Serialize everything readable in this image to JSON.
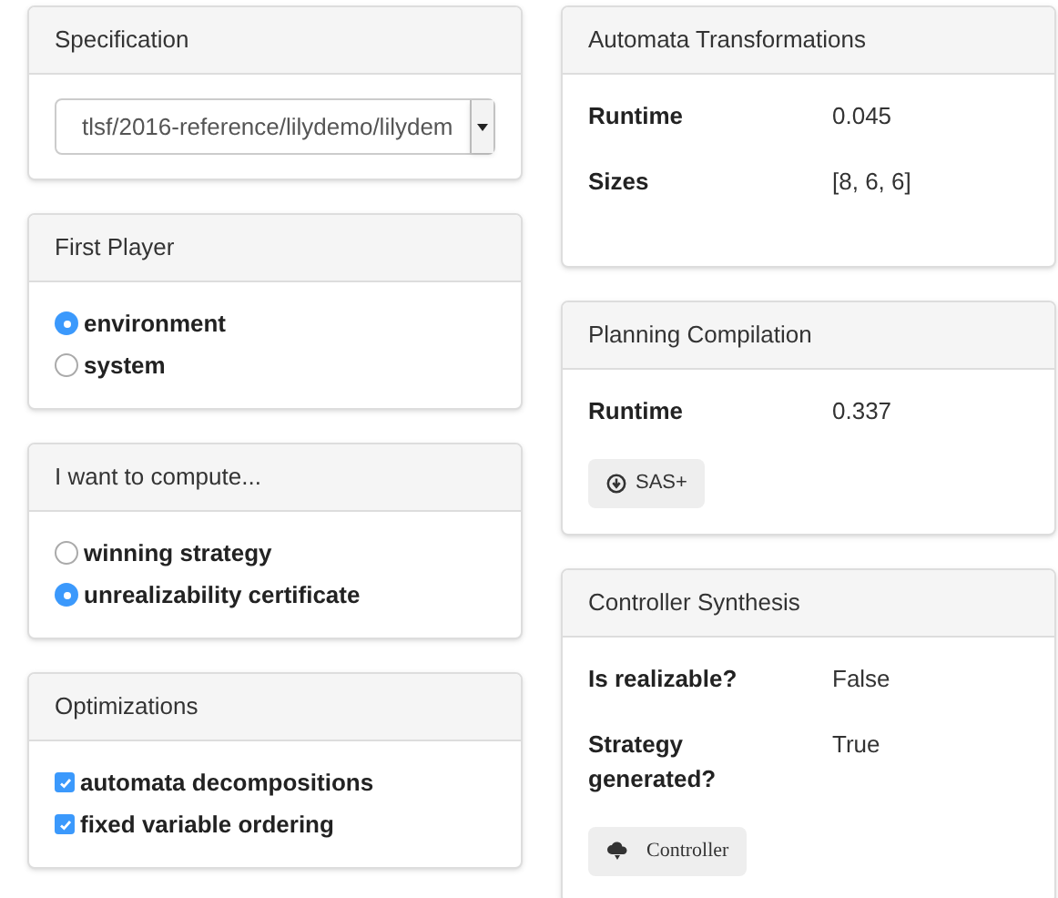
{
  "left_panels": [
    {
      "kind": "select",
      "title": "Specification",
      "value": "tlsf/2016-reference/lilydemo/lilydem"
    },
    {
      "kind": "radio",
      "title": "First Player",
      "options": [
        {
          "label": "environment",
          "selected": true
        },
        {
          "label": "system",
          "selected": false
        }
      ]
    },
    {
      "kind": "radio",
      "title": "I want to compute...",
      "options": [
        {
          "label": "winning strategy",
          "selected": false
        },
        {
          "label": "unrealizability certificate",
          "selected": true
        }
      ]
    },
    {
      "kind": "checkbox",
      "title": "Optimizations",
      "options": [
        {
          "label": "automata decompositions",
          "checked": true
        },
        {
          "label": "fixed variable ordering",
          "checked": true
        }
      ]
    }
  ],
  "right_panels": [
    {
      "title": "Automata Transformations",
      "rows": [
        {
          "label": "Runtime",
          "value": "0.045"
        },
        {
          "label": "Sizes",
          "value": "[8, 6, 6]"
        }
      ]
    },
    {
      "title": "Planning Compilation",
      "rows": [
        {
          "label": "Runtime",
          "value": "0.337"
        }
      ],
      "button": {
        "label": "SAS+",
        "kind": "download"
      }
    },
    {
      "title": "Controller Synthesis",
      "rows": [
        {
          "label": "Is realizable?",
          "value": "False"
        },
        {
          "label": "Strategy generated?",
          "value": "True"
        }
      ],
      "button": {
        "label": "Controller",
        "kind": "cloud"
      }
    }
  ]
}
